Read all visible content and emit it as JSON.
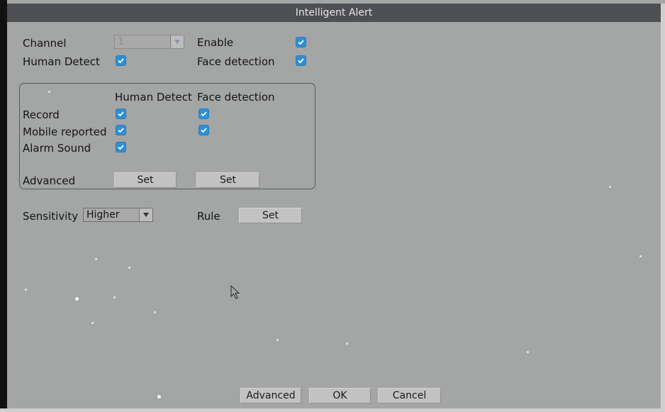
{
  "window": {
    "title": "Intelligent Alert"
  },
  "top": {
    "channel_label": "Channel",
    "channel_value": "1",
    "enable_label": "Enable",
    "human_detect_label": "Human Detect",
    "face_detection_label": "Face detection",
    "enable_checked": true,
    "human_detect_checked": true,
    "face_detection_checked": true
  },
  "group": {
    "col_human": "Human Detect",
    "col_face": "Face detection",
    "rows": [
      {
        "label": "Record",
        "human": true,
        "face": true
      },
      {
        "label": "Mobile reported",
        "human": true,
        "face": true
      },
      {
        "label": "Alarm Sound",
        "human": true
      }
    ],
    "advanced_label": "Advanced",
    "set_human": "Set",
    "set_face": "Set"
  },
  "sensitivity": {
    "label": "Sensitivity",
    "value": "Higher"
  },
  "rule": {
    "label": "Rule",
    "set": "Set"
  },
  "footer": {
    "advanced": "Advanced",
    "ok": "OK",
    "cancel": "Cancel"
  },
  "colors": {
    "background": "#a4a5a5",
    "titlebar": "#4e4f52",
    "checkbox": "#2e8fd5"
  },
  "icons": {
    "checkbox": "check-icon",
    "dropdown": "chevron-down-icon",
    "cursor": "mouse-pointer-icon"
  }
}
